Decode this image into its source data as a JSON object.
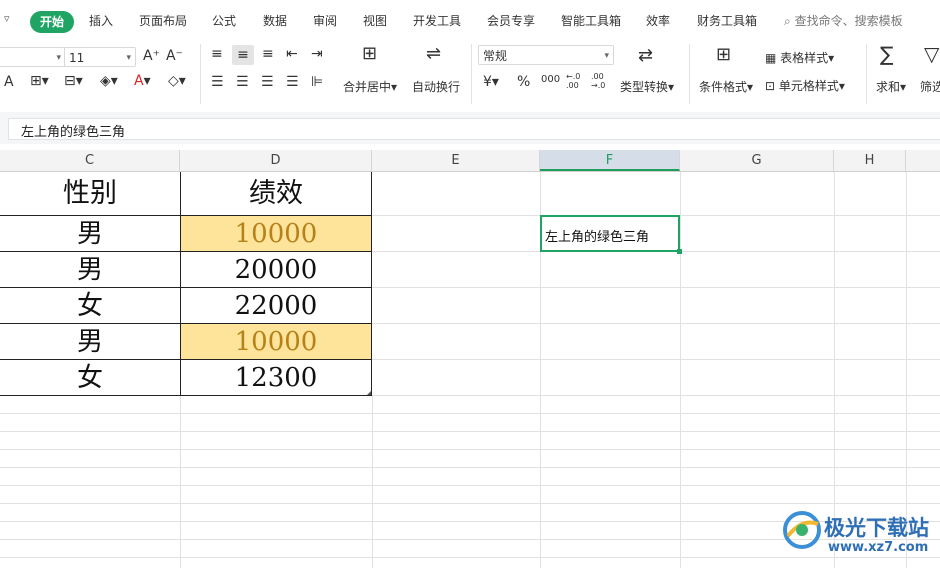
{
  "tabs": {
    "menu_arrow": "▿",
    "active": "开始",
    "items": [
      "插入",
      "页面布局",
      "公式",
      "数据",
      "审阅",
      "视图",
      "开发工具",
      "会员专享",
      "智能工具箱",
      "效率",
      "财务工具箱"
    ],
    "search": "查找命令、搜索模板"
  },
  "ribbon": {
    "font_size": "11",
    "font_grow": "A⁺",
    "font_shrink": "A⁻",
    "merge_center": "合并居中",
    "wrap_text": "自动换行",
    "number_format": "常规",
    "currency_symbol": "¥",
    "percent_symbol": "%",
    "thousands_symbol": "000",
    "dec_increase": "←.0 .00",
    "dec_decrease": ".00 →.0",
    "type_convert": "类型转换",
    "conditional_format": "条件格式",
    "table_style": "表格样式",
    "cell_style": "单元格样式",
    "sum": "求和",
    "filter": "筛选"
  },
  "formula_bar": {
    "content": "左上角的绿色三角"
  },
  "columns": [
    "C",
    "D",
    "E",
    "F",
    "G",
    "H"
  ],
  "table": {
    "headers": [
      "性别",
      "绩效"
    ],
    "rows": [
      {
        "gender": "男",
        "score": "10000",
        "highlight": true
      },
      {
        "gender": "男",
        "score": "20000",
        "highlight": false
      },
      {
        "gender": "女",
        "score": "22000",
        "highlight": false
      },
      {
        "gender": "男",
        "score": "10000",
        "highlight": true
      },
      {
        "gender": "女",
        "score": "12300",
        "highlight": false
      }
    ]
  },
  "active_cell": {
    "column": "F",
    "text": "左上角的绿色三角"
  },
  "colors": {
    "accent": "#1fa463",
    "highlight_fill": "#fde49a",
    "highlight_text": "#b5821a"
  },
  "watermark": {
    "title": "极光下载站",
    "url": "www.xz7.com"
  }
}
